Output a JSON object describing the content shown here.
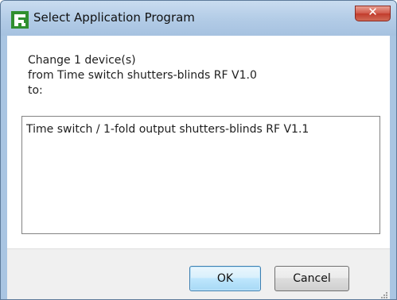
{
  "window": {
    "title": "Select Application Program",
    "close_label": "✕",
    "app_icon": "ets-app-icon"
  },
  "message": {
    "lines": [
      "Change 1 device(s)",
      "from Time switch shutters-blinds RF V1.0",
      "to:"
    ]
  },
  "program_list": {
    "items": [
      {
        "label": "Time switch / 1-fold output shutters-blinds RF V1.1"
      }
    ]
  },
  "buttons": {
    "ok": "OK",
    "cancel": "Cancel"
  },
  "colors": {
    "titlebar": "#b2cbe6",
    "close_button": "#c13b2c",
    "ok_border": "#3c7fb1",
    "footer": "#f0f0f0"
  }
}
